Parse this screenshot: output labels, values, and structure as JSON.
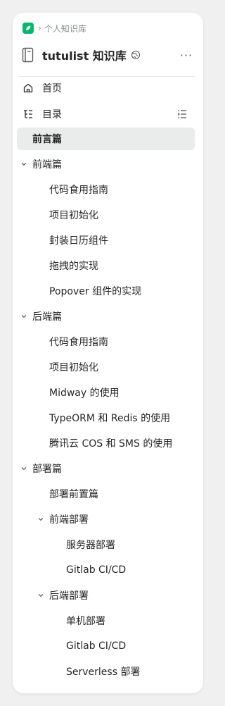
{
  "breadcrumb": {
    "separator": "›",
    "label": "个人知识库"
  },
  "knowledge_base": {
    "title": "tutulist 知识库",
    "more": "···"
  },
  "nav": {
    "home_label": "首页",
    "toc_label": "目录"
  },
  "tree": [
    {
      "label": "前言篇",
      "level": 0,
      "expandable": false,
      "active": true
    },
    {
      "label": "前端篇",
      "level": 0,
      "expandable": true,
      "expanded": true
    },
    {
      "label": "代码食用指南",
      "level": 1,
      "expandable": false
    },
    {
      "label": "项目初始化",
      "level": 1,
      "expandable": false
    },
    {
      "label": "封装日历组件",
      "level": 1,
      "expandable": false
    },
    {
      "label": "拖拽的实现",
      "level": 1,
      "expandable": false
    },
    {
      "label": "Popover 组件的实现",
      "level": 1,
      "expandable": false
    },
    {
      "label": "后端篇",
      "level": 0,
      "expandable": true,
      "expanded": true
    },
    {
      "label": "代码食用指南",
      "level": 1,
      "expandable": false
    },
    {
      "label": "项目初始化",
      "level": 1,
      "expandable": false
    },
    {
      "label": "Midway 的使用",
      "level": 1,
      "expandable": false
    },
    {
      "label": "TypeORM 和 Redis 的使用",
      "level": 1,
      "expandable": false
    },
    {
      "label": "腾讯云 COS 和 SMS 的使用",
      "level": 1,
      "expandable": false
    },
    {
      "label": "部署篇",
      "level": 0,
      "expandable": true,
      "expanded": true
    },
    {
      "label": "部署前置篇",
      "level": 1,
      "expandable": false
    },
    {
      "label": "前端部署",
      "level": 1,
      "expandable": true,
      "expanded": true
    },
    {
      "label": "服务器部署",
      "level": 2,
      "expandable": false
    },
    {
      "label": "Gitlab CI/CD",
      "level": 2,
      "expandable": false
    },
    {
      "label": "后端部署",
      "level": 1,
      "expandable": true,
      "expanded": true
    },
    {
      "label": "单机部署",
      "level": 2,
      "expandable": false
    },
    {
      "label": "Gitlab CI/CD",
      "level": 2,
      "expandable": false
    },
    {
      "label": "Serverless 部署",
      "level": 2,
      "expandable": false
    }
  ],
  "colors": {
    "brand": "#00b96b",
    "active_bg": "#eaebeb",
    "text": "#262626",
    "muted": "#8a8f8d"
  },
  "icons": {
    "logo": "yuque-logo-icon",
    "book": "book-icon",
    "globe": "globe-icon",
    "home": "home-icon",
    "toc": "toc-icon",
    "toc_toggle": "toc-toggle-icon",
    "caret": "chevron-down-icon"
  }
}
